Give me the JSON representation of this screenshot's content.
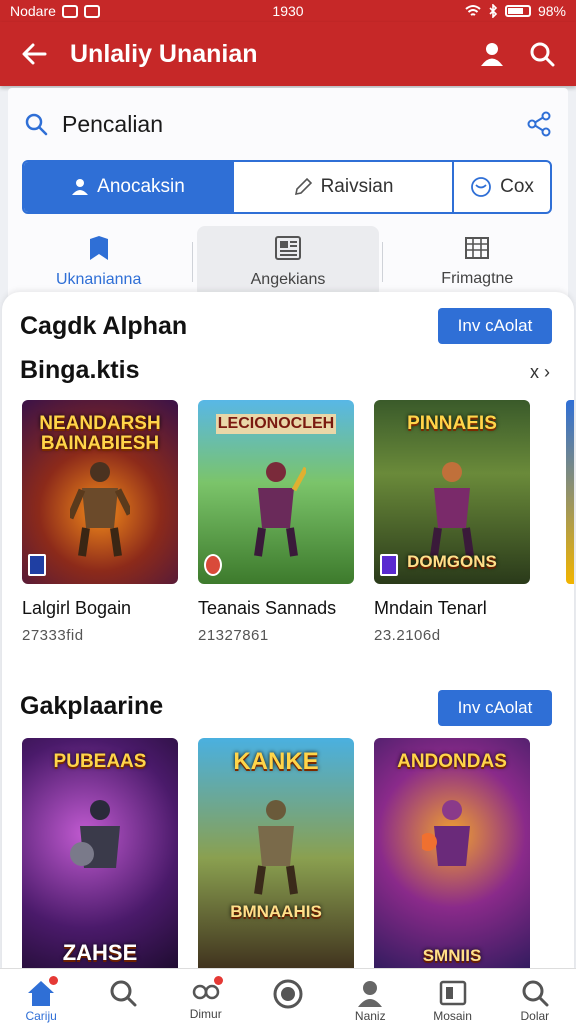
{
  "status_bar": {
    "carrier": "Nodare",
    "time": "1930",
    "battery": "98%"
  },
  "app_bar": {
    "title": "Unlaliy Unanian"
  },
  "search": {
    "placeholder": "Pencalian"
  },
  "segments": [
    {
      "label": "Anocaksin",
      "icon": "person-icon"
    },
    {
      "label": "Raivsian",
      "icon": "pencil-icon"
    },
    {
      "label": "Cox",
      "icon": "smile-icon"
    }
  ],
  "sub_tabs": [
    {
      "label": "Uknanianna",
      "icon": "bookmark-icon"
    },
    {
      "label": "Angekians",
      "icon": "news-icon"
    },
    {
      "label": "Frimagtne",
      "icon": "grid-icon"
    }
  ],
  "section1": {
    "title": "Cagdk Alphan",
    "subtitle": "Binga.ktis",
    "button": "Inv cAolat",
    "nav_arrows": "x ›",
    "items": [
      {
        "art_title": "NEANDARSH BAINABIESH",
        "art_footer": "",
        "name": "Lalgirl Bogain",
        "meta": "27333fid"
      },
      {
        "art_title": "LECIONOCLEH",
        "art_footer": "",
        "name": "Teanais Sannads",
        "meta": "21327861"
      },
      {
        "art_title": "PINNAEIS",
        "art_footer": "DOMGONS",
        "name": "Mndain Tenarl",
        "meta": "23.2106d"
      }
    ]
  },
  "section2": {
    "title": "Gakplaarine",
    "button": "Inv cAolat",
    "items": [
      {
        "art_title": "PUBEAAS",
        "art_footer": "ZAHSE"
      },
      {
        "art_title": "KANKE",
        "art_footer": "BMNAAHIS"
      },
      {
        "art_title": "ANDONDAS",
        "art_footer": "SMNIIS"
      }
    ]
  },
  "bottom_nav": [
    {
      "label": "Cariju",
      "icon": "home-icon",
      "active": true
    },
    {
      "label": "",
      "icon": "search-icon"
    },
    {
      "label": "Dimur",
      "icon": "gamepad-icon"
    },
    {
      "label": "",
      "icon": "record-icon"
    },
    {
      "label": "Naniz",
      "icon": "profile-icon"
    },
    {
      "label": "Mosain",
      "icon": "library-icon"
    },
    {
      "label": "Dolar",
      "icon": "search-icon"
    }
  ],
  "colors": {
    "primary": "#c62828",
    "accent": "#2f6fd6"
  }
}
